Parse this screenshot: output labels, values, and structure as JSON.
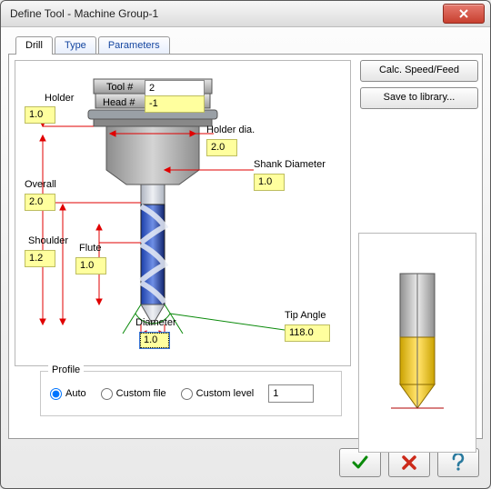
{
  "window": {
    "title": "Define Tool - Machine Group-1"
  },
  "tabs": {
    "drill": "Drill",
    "type": "Type",
    "parameters": "Parameters"
  },
  "rightButtons": {
    "calc": "Calc. Speed/Feed",
    "save": "Save to library..."
  },
  "labels": {
    "tool_num": "Tool #",
    "head_num": "Head #",
    "holder": "Holder",
    "holder_dia": "Holder dia.",
    "shank_dia": "Shank Diameter",
    "overall": "Overall",
    "shoulder": "Shoulder",
    "flute": "Flute",
    "diameter": "Diameter",
    "tip_angle": "Tip Angle"
  },
  "fields": {
    "tool_num": "2",
    "head_num": "-1",
    "holder": "1.0",
    "holder_dia": "2.0",
    "shank_dia": "1.0",
    "overall": "2.0",
    "shoulder": "1.2",
    "flute": "1.0",
    "diameter": "1.0",
    "tip_angle": "118.0"
  },
  "profile": {
    "legend": "Profile",
    "auto": "Auto",
    "custom_file": "Custom file",
    "custom_level": "Custom level",
    "level_value": "1",
    "selected": "auto"
  }
}
